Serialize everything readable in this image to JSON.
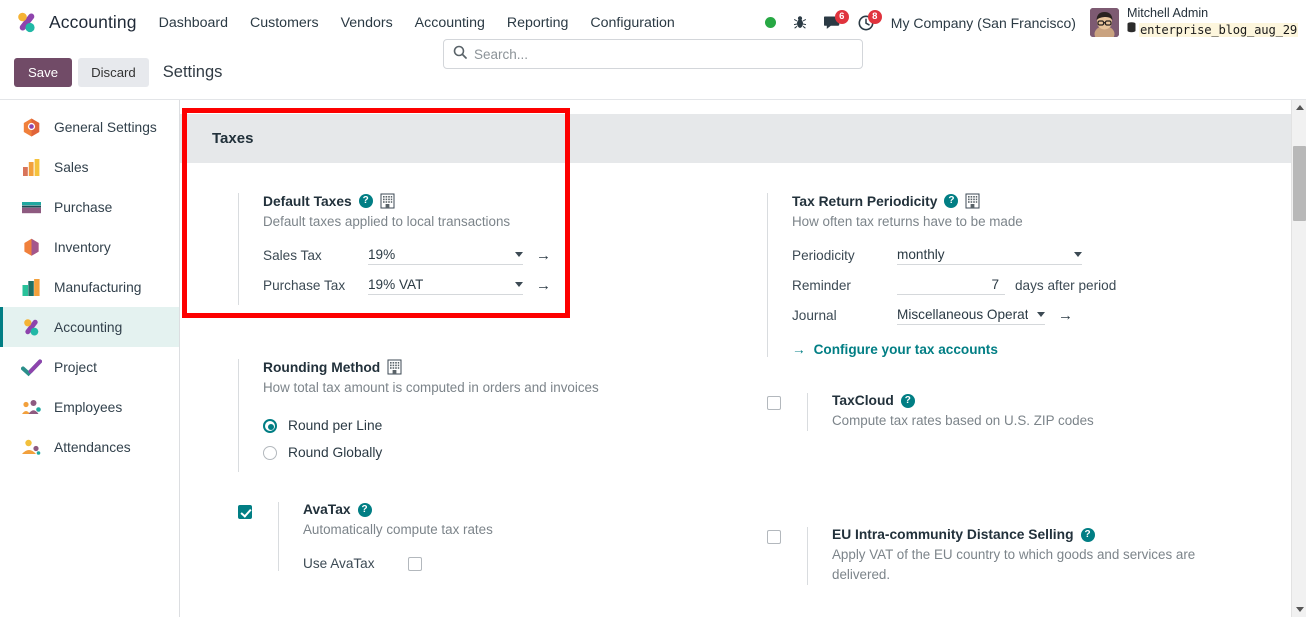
{
  "navbar": {
    "brand": "Accounting",
    "menu": [
      "Dashboard",
      "Customers",
      "Vendors",
      "Accounting",
      "Reporting",
      "Configuration"
    ],
    "status_dot_icon": "green-status-dot",
    "bug_icon": "bug-icon",
    "messages_icon": "chat-bubble-icon",
    "messages_count": "6",
    "activities_icon": "clock-icon",
    "activities_count": "8",
    "company": "My Company (San Francisco)",
    "user_name": "Mitchell Admin",
    "database": "enterprise_blog_aug_29",
    "db_icon": "database-icon"
  },
  "control_panel": {
    "save_label": "Save",
    "discard_label": "Discard",
    "title": "Settings",
    "search_placeholder": "Search...",
    "search_value": "",
    "search_icon": "search-icon"
  },
  "sidebar": {
    "items": [
      {
        "label": "General Settings",
        "icon": "general-settings-icon",
        "active": false
      },
      {
        "label": "Sales",
        "icon": "sales-icon",
        "active": false
      },
      {
        "label": "Purchase",
        "icon": "purchase-icon",
        "active": false
      },
      {
        "label": "Inventory",
        "icon": "inventory-icon",
        "active": false
      },
      {
        "label": "Manufacturing",
        "icon": "manufacturing-icon",
        "active": false
      },
      {
        "label": "Accounting",
        "icon": "accounting-icon",
        "active": true
      },
      {
        "label": "Project",
        "icon": "project-icon",
        "active": false
      },
      {
        "label": "Employees",
        "icon": "employees-icon",
        "active": false
      },
      {
        "label": "Attendances",
        "icon": "attendances-icon",
        "active": false
      }
    ]
  },
  "section": {
    "title": "Taxes"
  },
  "settings": {
    "default_taxes": {
      "title": "Default Taxes",
      "description": "Default taxes applied to local transactions",
      "help_icon": "question-mark-icon",
      "company_icon": "company-building-icon",
      "sales_tax_label": "Sales Tax",
      "sales_tax_value": "19%",
      "purchase_tax_label": "Purchase Tax",
      "purchase_tax_value": "19% VAT",
      "internal_link_icon": "arrow-right-icon"
    },
    "tax_return_periodicity": {
      "title": "Tax Return Periodicity",
      "description": "How often tax returns have to be made",
      "help_icon": "question-mark-icon",
      "company_icon": "company-building-icon",
      "periodicity_label": "Periodicity",
      "periodicity_value": "monthly",
      "reminder_label": "Reminder",
      "reminder_value": "7",
      "reminder_suffix": "days after period",
      "journal_label": "Journal",
      "journal_value": "Miscellaneous Operat",
      "configure_link": "Configure your tax accounts",
      "configure_icon": "arrow-right-icon"
    },
    "rounding_method": {
      "title": "Rounding Method",
      "description": "How total tax amount is computed in orders and invoices",
      "company_icon": "company-building-icon",
      "options": [
        {
          "label": "Round per Line",
          "selected": true
        },
        {
          "label": "Round Globally",
          "selected": false
        }
      ]
    },
    "taxcloud": {
      "title": "TaxCloud",
      "description": "Compute tax rates based on U.S. ZIP codes",
      "help_icon": "question-mark-icon",
      "checked": false
    },
    "avatax": {
      "title": "AvaTax",
      "description": "Automatically compute tax rates",
      "help_icon": "question-mark-icon",
      "checked": true,
      "use_avatax_label": "Use AvaTax",
      "use_avatax_checked": false
    },
    "eu_distance_selling": {
      "title": "EU Intra-community Distance Selling",
      "description": "Apply VAT of the EU country to which goods and services are delivered.",
      "help_icon": "question-mark-icon",
      "checked": false
    }
  },
  "scrollbar": {
    "up_icon": "scroll-up-arrow-icon",
    "down_icon": "scroll-down-arrow-icon",
    "thumb": "scrollbar-thumb"
  },
  "annotation": {
    "highlight_color": "#fd0000"
  }
}
